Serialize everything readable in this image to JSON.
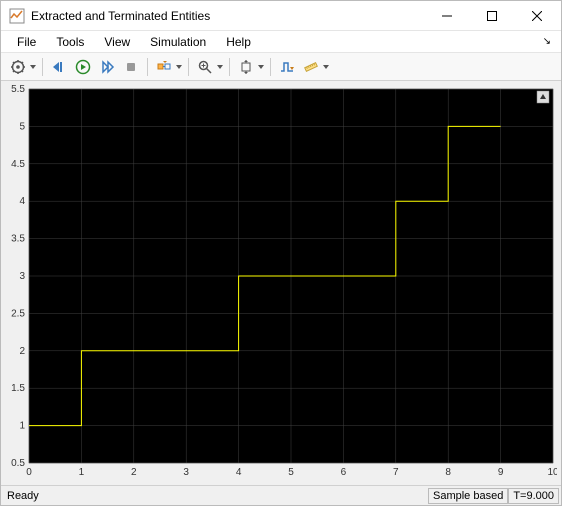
{
  "window": {
    "title": "Extracted and Terminated Entities"
  },
  "menu": {
    "items": [
      "File",
      "Tools",
      "View",
      "Simulation",
      "Help"
    ]
  },
  "toolbar": {
    "groups": [
      [
        "settings-gear"
      ],
      [
        "step-back",
        "run",
        "step-forward",
        "stop"
      ],
      [
        "highlight-block"
      ],
      [
        "zoom"
      ],
      [
        "autoscale"
      ],
      [
        "triggers",
        "measurements"
      ]
    ]
  },
  "status": {
    "ready": "Ready",
    "sample": "Sample based",
    "time": "T=9.000"
  },
  "chart_data": {
    "type": "line",
    "step_mode": "post",
    "x": [
      0,
      1,
      1,
      4,
      4,
      7,
      7,
      8,
      8,
      9,
      9
    ],
    "y": [
      1,
      1,
      2,
      2,
      3,
      3,
      4,
      4,
      5,
      5,
      5
    ],
    "xlim": [
      0,
      10
    ],
    "ylim": [
      0.5,
      5.5
    ],
    "xticks": [
      0,
      1,
      2,
      3,
      4,
      5,
      6,
      7,
      8,
      9,
      10
    ],
    "yticks": [
      0.5,
      1,
      1.5,
      2,
      2.5,
      3,
      3.5,
      4,
      4.5,
      5,
      5.5
    ],
    "line_color": "#ffff00",
    "bg_color": "#000000",
    "grid_color": "#404040",
    "title": "",
    "xlabel": "",
    "ylabel": ""
  }
}
